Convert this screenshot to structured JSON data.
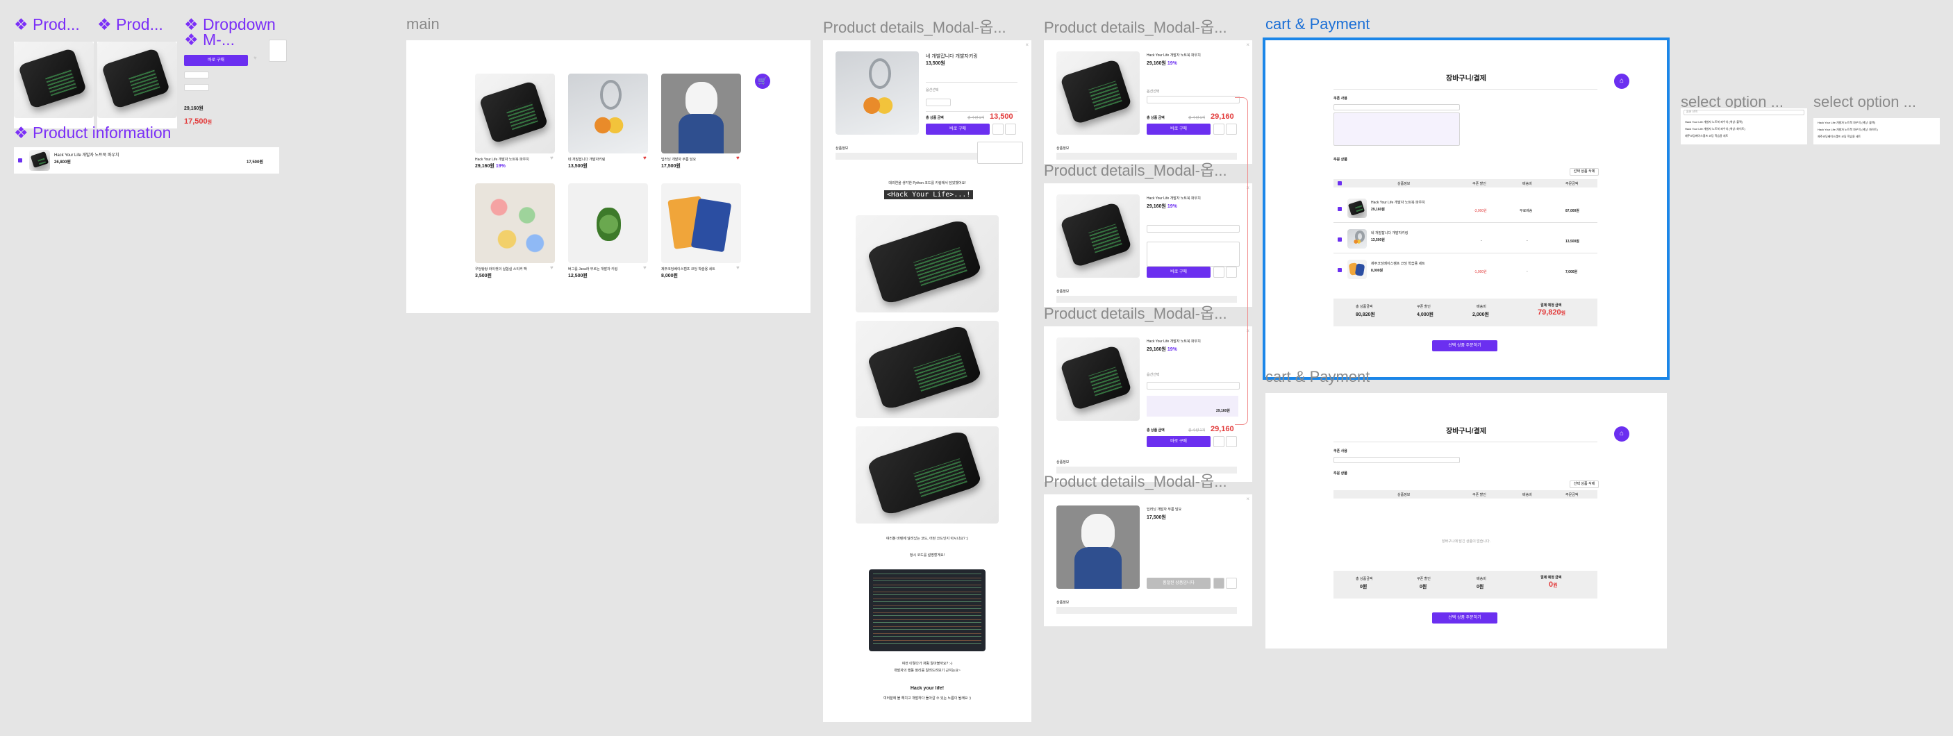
{
  "canvas": {
    "components": {
      "product_card_1": "❖ Prod...",
      "product_card_2": "❖ Prod...",
      "dropdown": "❖ Dropdown",
      "dropdown_sub": "❖ M-...",
      "product_information": "❖ Product information",
      "dropdown_button": "바로 구매",
      "dropdown_price": "17,500",
      "dropdown_price_unit": "원",
      "pi_name": "Hack Your Life 개발자 노트북 파우치",
      "pi_price": "26,800원",
      "pi_total": "17,500원"
    },
    "frames": {
      "main": "main",
      "detail1": "Product details_Modal-옵...",
      "detail2": "Product details_Modal-옵...",
      "detail3": "Product details_Modal-옵...",
      "detail4": "Product details_Modal-옵...",
      "detail5": "Product details_Modal-옵...",
      "cart1": "cart & Payment",
      "cart2": "cart & Payment",
      "select1": "select option ...",
      "select2": "select option ..."
    }
  },
  "main": {
    "products": [
      {
        "name": "Hack Your Life 개발자 노트북 파우치",
        "price": "29,160",
        "unit": "원",
        "discount": "19%",
        "liked": false
      },
      {
        "name": "네 개발잡니다 개발자키링",
        "price": "13,500",
        "unit": "원",
        "liked": true
      },
      {
        "name": "딥러닝 개발자 무릎 담요",
        "price": "17,500",
        "unit": "원",
        "liked": true
      },
      {
        "name": "우당탕탕 라이캣의 실험실 스티커 팩",
        "price": "3,500",
        "unit": "원",
        "liked": false
      },
      {
        "name": "버그를 Java라 부르는 개발자 키링",
        "price": "12,500",
        "unit": "원",
        "liked": false
      },
      {
        "name": "제주코딩베이스캠프 코딩 학습용 세트",
        "price": "8,000",
        "unit": "원",
        "liked": false
      }
    ]
  },
  "detail_long": {
    "name": "네 개발잡니다 개발자키링",
    "price": "13,500",
    "unit": "원",
    "option_label": "옵션선택",
    "total_label": "총 상품 금액",
    "total_strike": "총 수량 1개",
    "total_price": "13,500",
    "buy_button": "바로 구매",
    "info_label": "상품정보",
    "intro": "대리연을 생각한 Python 코드를 키링에서 담았했어요!",
    "code_title": "<Hack Your Life>...!",
    "desc1": "여러분 바텐에 달려있는 코드, 어떤 코드인지 아시나요? :)",
    "desc2": "정시 코드를 설명할게요!",
    "desc3": "여전 이렇다가 처럼 알아볼까요? :-)",
    "desc4": "개발자의 행동 정리를 알려드려보기 근지는요~",
    "slogan": "Hack your life!",
    "footer": "여러분에 블 해치고 개발하다 돌아갈 수 있는 노름이 될래요 :)"
  },
  "detail_short": {
    "name": "Hack Your Life 개발자 노트북 파우치",
    "price": "29,160",
    "unit": "원",
    "discount": "19%",
    "option_label": "옵션선택",
    "total_label": "총 상품 금액",
    "total_strike": "총 수량 1개",
    "total_price": "29,160",
    "buy_button": "바로 구매",
    "info_label": "상품정보",
    "option_amount": "29,160원"
  },
  "detail_soldout": {
    "name": "딥러닝 개발자 무릎 담요",
    "price": "17,500",
    "unit": "원",
    "soldout_button": "품절된 상품입니다",
    "info_label": "상품정보"
  },
  "cart": {
    "title": "장바구니/결제",
    "coupon_label": "쿠폰 사용",
    "items_label": "주문 상품",
    "delete_button": "선택 상품 삭제",
    "headers": [
      "상품정보",
      "쿠폰 할인",
      "배송비",
      "주문금액"
    ],
    "rows": [
      {
        "name": "Hack Your Life 개발자 노트북 파우치",
        "price": "29,160원",
        "coupon": "-3,000원",
        "ship": "무료배송",
        "total": "87,000원"
      },
      {
        "name": "네 개발잡니다 개발자키링",
        "price": "13,500원",
        "coupon": "-",
        "ship": "-",
        "total": "13,500원"
      },
      {
        "name": "제주코딩베이스캠프 코딩 학습용 세트",
        "price": "8,000원",
        "coupon": "-1,000원",
        "ship": "-",
        "total": "7,000원"
      }
    ],
    "summary": {
      "product_label": "총 상품금액",
      "product_value": "80,820원",
      "discount_label": "쿠폰 할인",
      "discount_value": "4,000원",
      "ship_label": "배송비",
      "ship_value": "2,000원",
      "final_label": "결제 예정 금액",
      "final_value": "79,820",
      "final_unit": "원"
    },
    "order_button": "선택 상품 주문하기",
    "empty_text": "장바구니에 담긴 상품이 없습니다.",
    "empty_summary": {
      "product_value": "0원",
      "discount_value": "0원",
      "ship_value": "0원",
      "final_value": "0",
      "final_unit": "원"
    }
  },
  "select_option": {
    "placeholder": "옵션 선택",
    "options": [
      "Hack Your Life 개발자 노트북 파우치 (색상: 블랙)",
      "Hack Your Life 개발자 노트북 파우치 (색상: 화이트)",
      "제주코딩베이스캠프 코딩 학습용 세트"
    ]
  },
  "colors": {
    "accent": "#6b2ff0",
    "sale": "#e23b3b",
    "selection": "#1b86e8"
  }
}
